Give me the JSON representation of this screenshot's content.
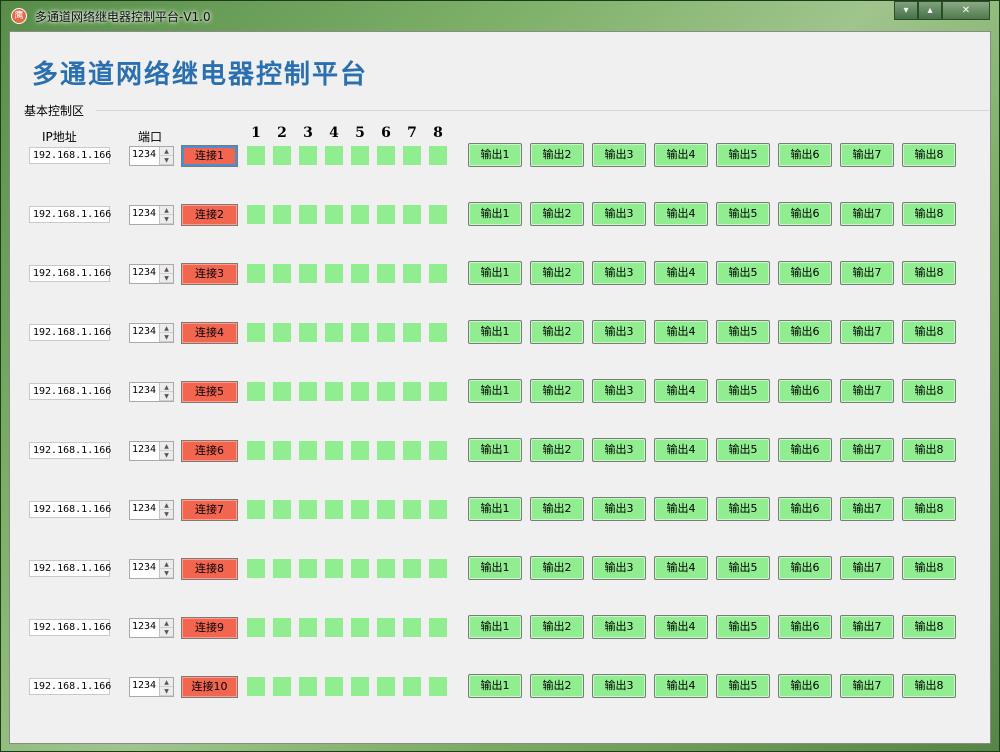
{
  "window": {
    "title": "多通道网络继电器控制平台-V1.0",
    "icon_char": "鹰",
    "controls": [
      "▾",
      "▴",
      "✕"
    ]
  },
  "app_title": "多通道网络继电器控制平台",
  "group_label": "基本控制区",
  "headers": {
    "ip": "IP地址",
    "port": "端口",
    "channels": [
      "1",
      "2",
      "3",
      "4",
      "5",
      "6",
      "7",
      "8"
    ]
  },
  "indicator_color": "#90ee90",
  "connect_color": "#f2654f",
  "rows": [
    {
      "ip": "192.168.1.166",
      "port": "1234",
      "connect": "连接1",
      "outputs": [
        "输出1",
        "输出2",
        "输出3",
        "输出4",
        "输出5",
        "输出6",
        "输出7",
        "输出8"
      ]
    },
    {
      "ip": "192.168.1.166",
      "port": "1234",
      "connect": "连接2",
      "outputs": [
        "输出1",
        "输出2",
        "输出3",
        "输出4",
        "输出5",
        "输出6",
        "输出7",
        "输出8"
      ]
    },
    {
      "ip": "192.168.1.166",
      "port": "1234",
      "connect": "连接3",
      "outputs": [
        "输出1",
        "输出2",
        "输出3",
        "输出4",
        "输出5",
        "输出6",
        "输出7",
        "输出8"
      ]
    },
    {
      "ip": "192.168.1.166",
      "port": "1234",
      "connect": "连接4",
      "outputs": [
        "输出1",
        "输出2",
        "输出3",
        "输出4",
        "输出5",
        "输出6",
        "输出7",
        "输出8"
      ]
    },
    {
      "ip": "192.168.1.166",
      "port": "1234",
      "connect": "连接5",
      "outputs": [
        "输出1",
        "输出2",
        "输出3",
        "输出4",
        "输出5",
        "输出6",
        "输出7",
        "输出8"
      ]
    },
    {
      "ip": "192.168.1.166",
      "port": "1234",
      "connect": "连接6",
      "outputs": [
        "输出1",
        "输出2",
        "输出3",
        "输出4",
        "输出5",
        "输出6",
        "输出7",
        "输出8"
      ]
    },
    {
      "ip": "192.168.1.166",
      "port": "1234",
      "connect": "连接7",
      "outputs": [
        "输出1",
        "输出2",
        "输出3",
        "输出4",
        "输出5",
        "输出6",
        "输出7",
        "输出8"
      ]
    },
    {
      "ip": "192.168.1.166",
      "port": "1234",
      "connect": "连接8",
      "outputs": [
        "输出1",
        "输出2",
        "输出3",
        "输出4",
        "输出5",
        "输出6",
        "输出7",
        "输出8"
      ]
    },
    {
      "ip": "192.168.1.166",
      "port": "1234",
      "connect": "连接9",
      "outputs": [
        "输出1",
        "输出2",
        "输出3",
        "输出4",
        "输出5",
        "输出6",
        "输出7",
        "输出8"
      ]
    },
    {
      "ip": "192.168.1.166",
      "port": "1234",
      "connect": "连接10",
      "outputs": [
        "输出1",
        "输出2",
        "输出3",
        "输出4",
        "输出5",
        "输出6",
        "输出7",
        "输出8"
      ]
    }
  ]
}
